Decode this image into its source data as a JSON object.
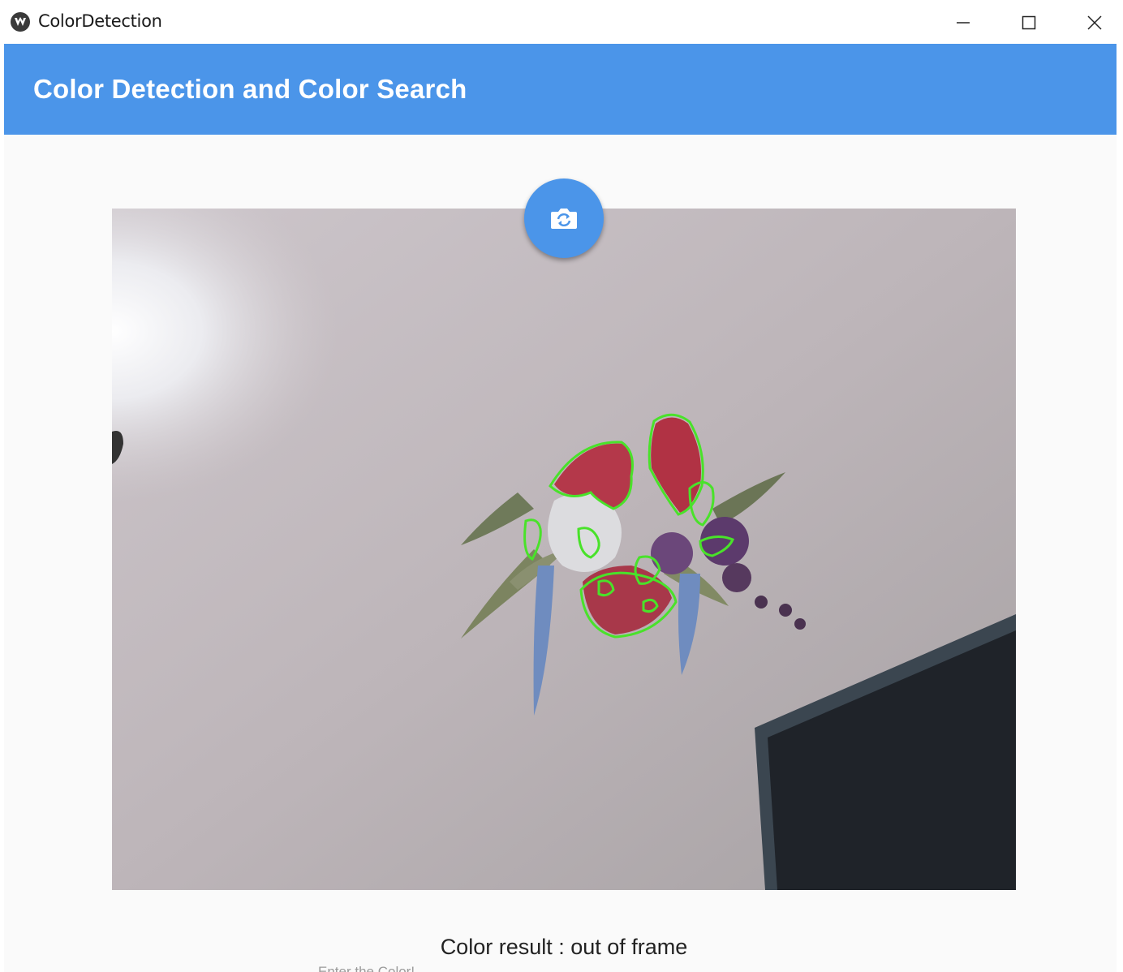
{
  "window": {
    "title": "ColorDetection"
  },
  "header": {
    "title": "Color Detection and Color Search"
  },
  "camera": {
    "switch_button_icon": "camera-switch-icon"
  },
  "result": {
    "text": "Color result : out of frame"
  },
  "color_search": {
    "placeholder": "Enter the Color!",
    "value": ""
  },
  "colors": {
    "accent": "#4b95e9",
    "contour": "#49e22a",
    "background": "#fafafa"
  }
}
